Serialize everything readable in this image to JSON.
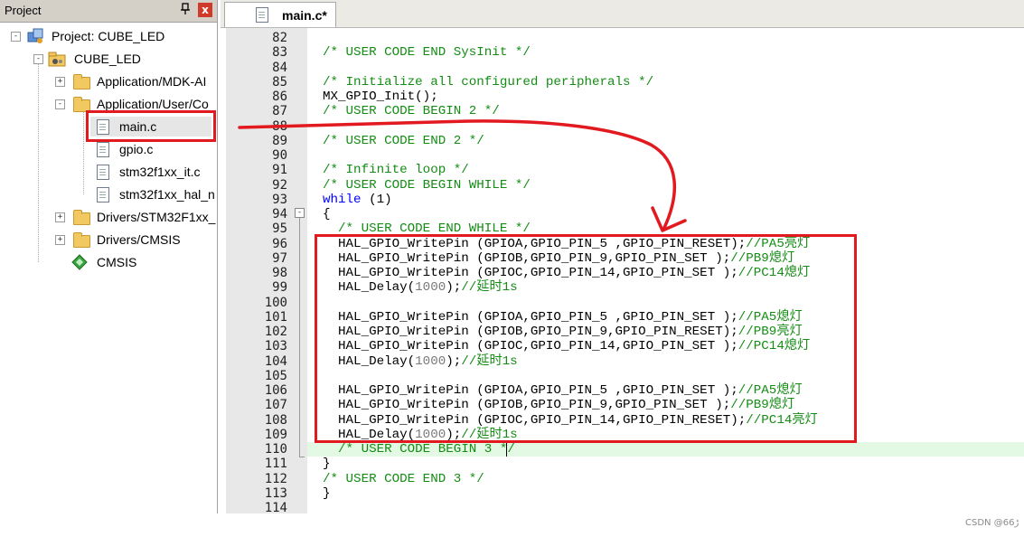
{
  "project_panel": {
    "title": "Project",
    "pin_glyph": "ᵖ",
    "close_glyph": "x",
    "tree": [
      {
        "label": "Project: CUBE_LED",
        "icon": "project-icon",
        "expander": "-"
      },
      {
        "label": "CUBE_LED",
        "icon": "target-folder-icon",
        "expander": "-"
      },
      {
        "label": "Application/MDK-AI",
        "icon": "folder-icon",
        "expander": "+"
      },
      {
        "label": "Application/User/Co",
        "icon": "folder-icon",
        "expander": "-"
      },
      {
        "label": "main.c",
        "icon": "file-icon",
        "expander": ""
      },
      {
        "label": "gpio.c",
        "icon": "file-icon",
        "expander": ""
      },
      {
        "label": "stm32f1xx_it.c",
        "icon": "file-icon",
        "expander": ""
      },
      {
        "label": "stm32f1xx_hal_n",
        "icon": "file-icon",
        "expander": ""
      },
      {
        "label": "Drivers/STM32F1xx_",
        "icon": "folder-icon",
        "expander": "+"
      },
      {
        "label": "Drivers/CMSIS",
        "icon": "folder-icon",
        "expander": "+"
      },
      {
        "label": "CMSIS",
        "icon": "cmsis-diamond-icon",
        "expander": ""
      }
    ]
  },
  "editor": {
    "tab_label": "main.c*",
    "fold_glyph": "-",
    "lines": [
      {
        "n": "82",
        "code": ""
      },
      {
        "n": "83",
        "code": "/* USER CODE END SysInit */"
      },
      {
        "n": "84",
        "code": ""
      },
      {
        "n": "85",
        "code": "/* Initialize all configured peripherals */"
      },
      {
        "n": "86",
        "code": "MX_GPIO_Init();"
      },
      {
        "n": "87",
        "code": "/* USER CODE BEGIN 2 */"
      },
      {
        "n": "88",
        "code": ""
      },
      {
        "n": "89",
        "code": "/* USER CODE END 2 */"
      },
      {
        "n": "90",
        "code": ""
      },
      {
        "n": "91",
        "code": "/* Infinite loop */"
      },
      {
        "n": "92",
        "code": "/* USER CODE BEGIN WHILE */"
      },
      {
        "n": "93",
        "code_kw": "while",
        "code_rest": " (1)"
      },
      {
        "n": "94",
        "code": "{"
      },
      {
        "n": "95",
        "code": "  /* USER CODE END WHILE */"
      },
      {
        "n": "96",
        "code_main": "  HAL_GPIO_WritePin (GPIOA,GPIO_PIN_5 ,GPIO_PIN_RESET);",
        "code_comment": "//PA5亮灯"
      },
      {
        "n": "97",
        "code_main": "  HAL_GPIO_WritePin (GPIOB,GPIO_PIN_9,GPIO_PIN_SET );",
        "code_comment": "//PB9熄灯"
      },
      {
        "n": "98",
        "code_main": "  HAL_GPIO_WritePin (GPIOC,GPIO_PIN_14,GPIO_PIN_SET );",
        "code_comment": "//PC14熄灯"
      },
      {
        "n": "99",
        "code_main": "  HAL_Delay(",
        "code_num": "1000",
        "code_tail": ");",
        "code_comment": "//延时1s"
      },
      {
        "n": "100",
        "code": ""
      },
      {
        "n": "101",
        "code_main": "  HAL_GPIO_WritePin (GPIOA,GPIO_PIN_5 ,GPIO_PIN_SET );",
        "code_comment": "//PA5熄灯"
      },
      {
        "n": "102",
        "code_main": "  HAL_GPIO_WritePin (GPIOB,GPIO_PIN_9,GPIO_PIN_RESET);",
        "code_comment": "//PB9亮灯"
      },
      {
        "n": "103",
        "code_main": "  HAL_GPIO_WritePin (GPIOC,GPIO_PIN_14,GPIO_PIN_SET );",
        "code_comment": "//PC14熄灯"
      },
      {
        "n": "104",
        "code_main": "  HAL_Delay(",
        "code_num": "1000",
        "code_tail": ");",
        "code_comment": "//延时1s"
      },
      {
        "n": "105",
        "code": ""
      },
      {
        "n": "106",
        "code_main": "  HAL_GPIO_WritePin (GPIOA,GPIO_PIN_5 ,GPIO_PIN_SET );",
        "code_comment": "//PA5熄灯"
      },
      {
        "n": "107",
        "code_main": "  HAL_GPIO_WritePin (GPIOB,GPIO_PIN_9,GPIO_PIN_SET );",
        "code_comment": "//PB9熄灯"
      },
      {
        "n": "108",
        "code_main": "  HAL_GPIO_WritePin (GPIOC,GPIO_PIN_14,GPIO_PIN_RESET);",
        "code_comment": "//PC14亮灯"
      },
      {
        "n": "109",
        "code_main": "  HAL_Delay(",
        "code_num": "1000",
        "code_tail": ");",
        "code_comment": "//延时1s"
      },
      {
        "n": "110",
        "code": "  /* USER CODE BEGIN 3 */"
      },
      {
        "n": "111",
        "code": "}"
      },
      {
        "n": "112",
        "code": "/* USER CODE END 3 */"
      },
      {
        "n": "113",
        "code": "}"
      },
      {
        "n": "114",
        "code": ""
      }
    ]
  },
  "annotation_color": "#e2191f",
  "current_line_color": "#e4f9e4",
  "watermark": "CSDN @6ڑ6"
}
